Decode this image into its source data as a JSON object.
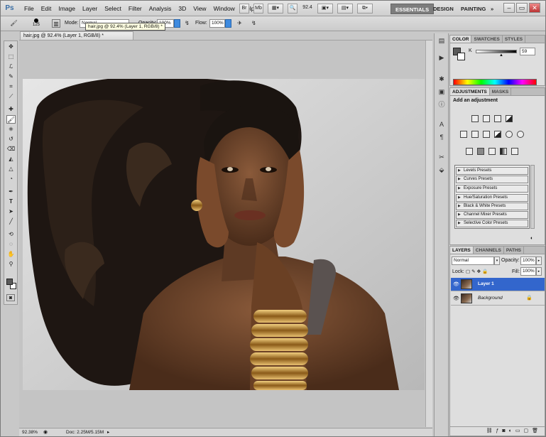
{
  "app": {
    "logo": "Ps"
  },
  "menu": [
    "File",
    "Edit",
    "Image",
    "Layer",
    "Select",
    "Filter",
    "Analysis",
    "3D",
    "View",
    "Window",
    "Help"
  ],
  "appbar": {
    "br_label": "Br",
    "mb_label": "Mb",
    "zoom": "92.4"
  },
  "workspaces": [
    "ESSENTIALS",
    "DESIGN",
    "PAINTING"
  ],
  "workspace_more": "»",
  "window_buttons": {
    "minimize": "–",
    "restore": "▭",
    "close": "✕"
  },
  "options": {
    "brush_size": "125",
    "mode_label": "Mode:",
    "mode_value": "Normal",
    "opacity_label": "Opacity:",
    "opacity_value": "100%",
    "flow_label": "Flow:",
    "flow_value": "100%"
  },
  "tooltip": "hair.jpg @ 92.4% (Layer 1, RGB/8) *",
  "document": {
    "tab": "hair.jpg @ 92.4% (Layer 1, RGB/8) *",
    "zoom": "92.38%",
    "docsize": "Doc: 2.25M/5.15M"
  },
  "color_panel": {
    "tabs": [
      "COLOR",
      "SWATCHES",
      "STYLES"
    ],
    "channel": "K",
    "value": "59"
  },
  "adjustments": {
    "tabs": [
      "ADJUSTMENTS",
      "MASKS"
    ],
    "title": "Add an adjustment",
    "presets": [
      "Levels Presets",
      "Curves Presets",
      "Exposure Presets",
      "Hue/Saturation Presets",
      "Black & White Presets",
      "Channel Mixer Presets",
      "Selective Color Presets"
    ]
  },
  "layers": {
    "tabs": [
      "LAYERS",
      "CHANNELS",
      "PATHS"
    ],
    "blend": "Normal",
    "opacity_label": "Opacity:",
    "opacity": "100%",
    "lock_label": "Lock:",
    "fill_label": "Fill:",
    "fill": "100%",
    "items": [
      {
        "name": "Layer 1",
        "selected": true
      },
      {
        "name": "Background",
        "selected": false
      }
    ]
  },
  "colors": {
    "accent": "#3f8be0",
    "selection": "#3366cc"
  }
}
